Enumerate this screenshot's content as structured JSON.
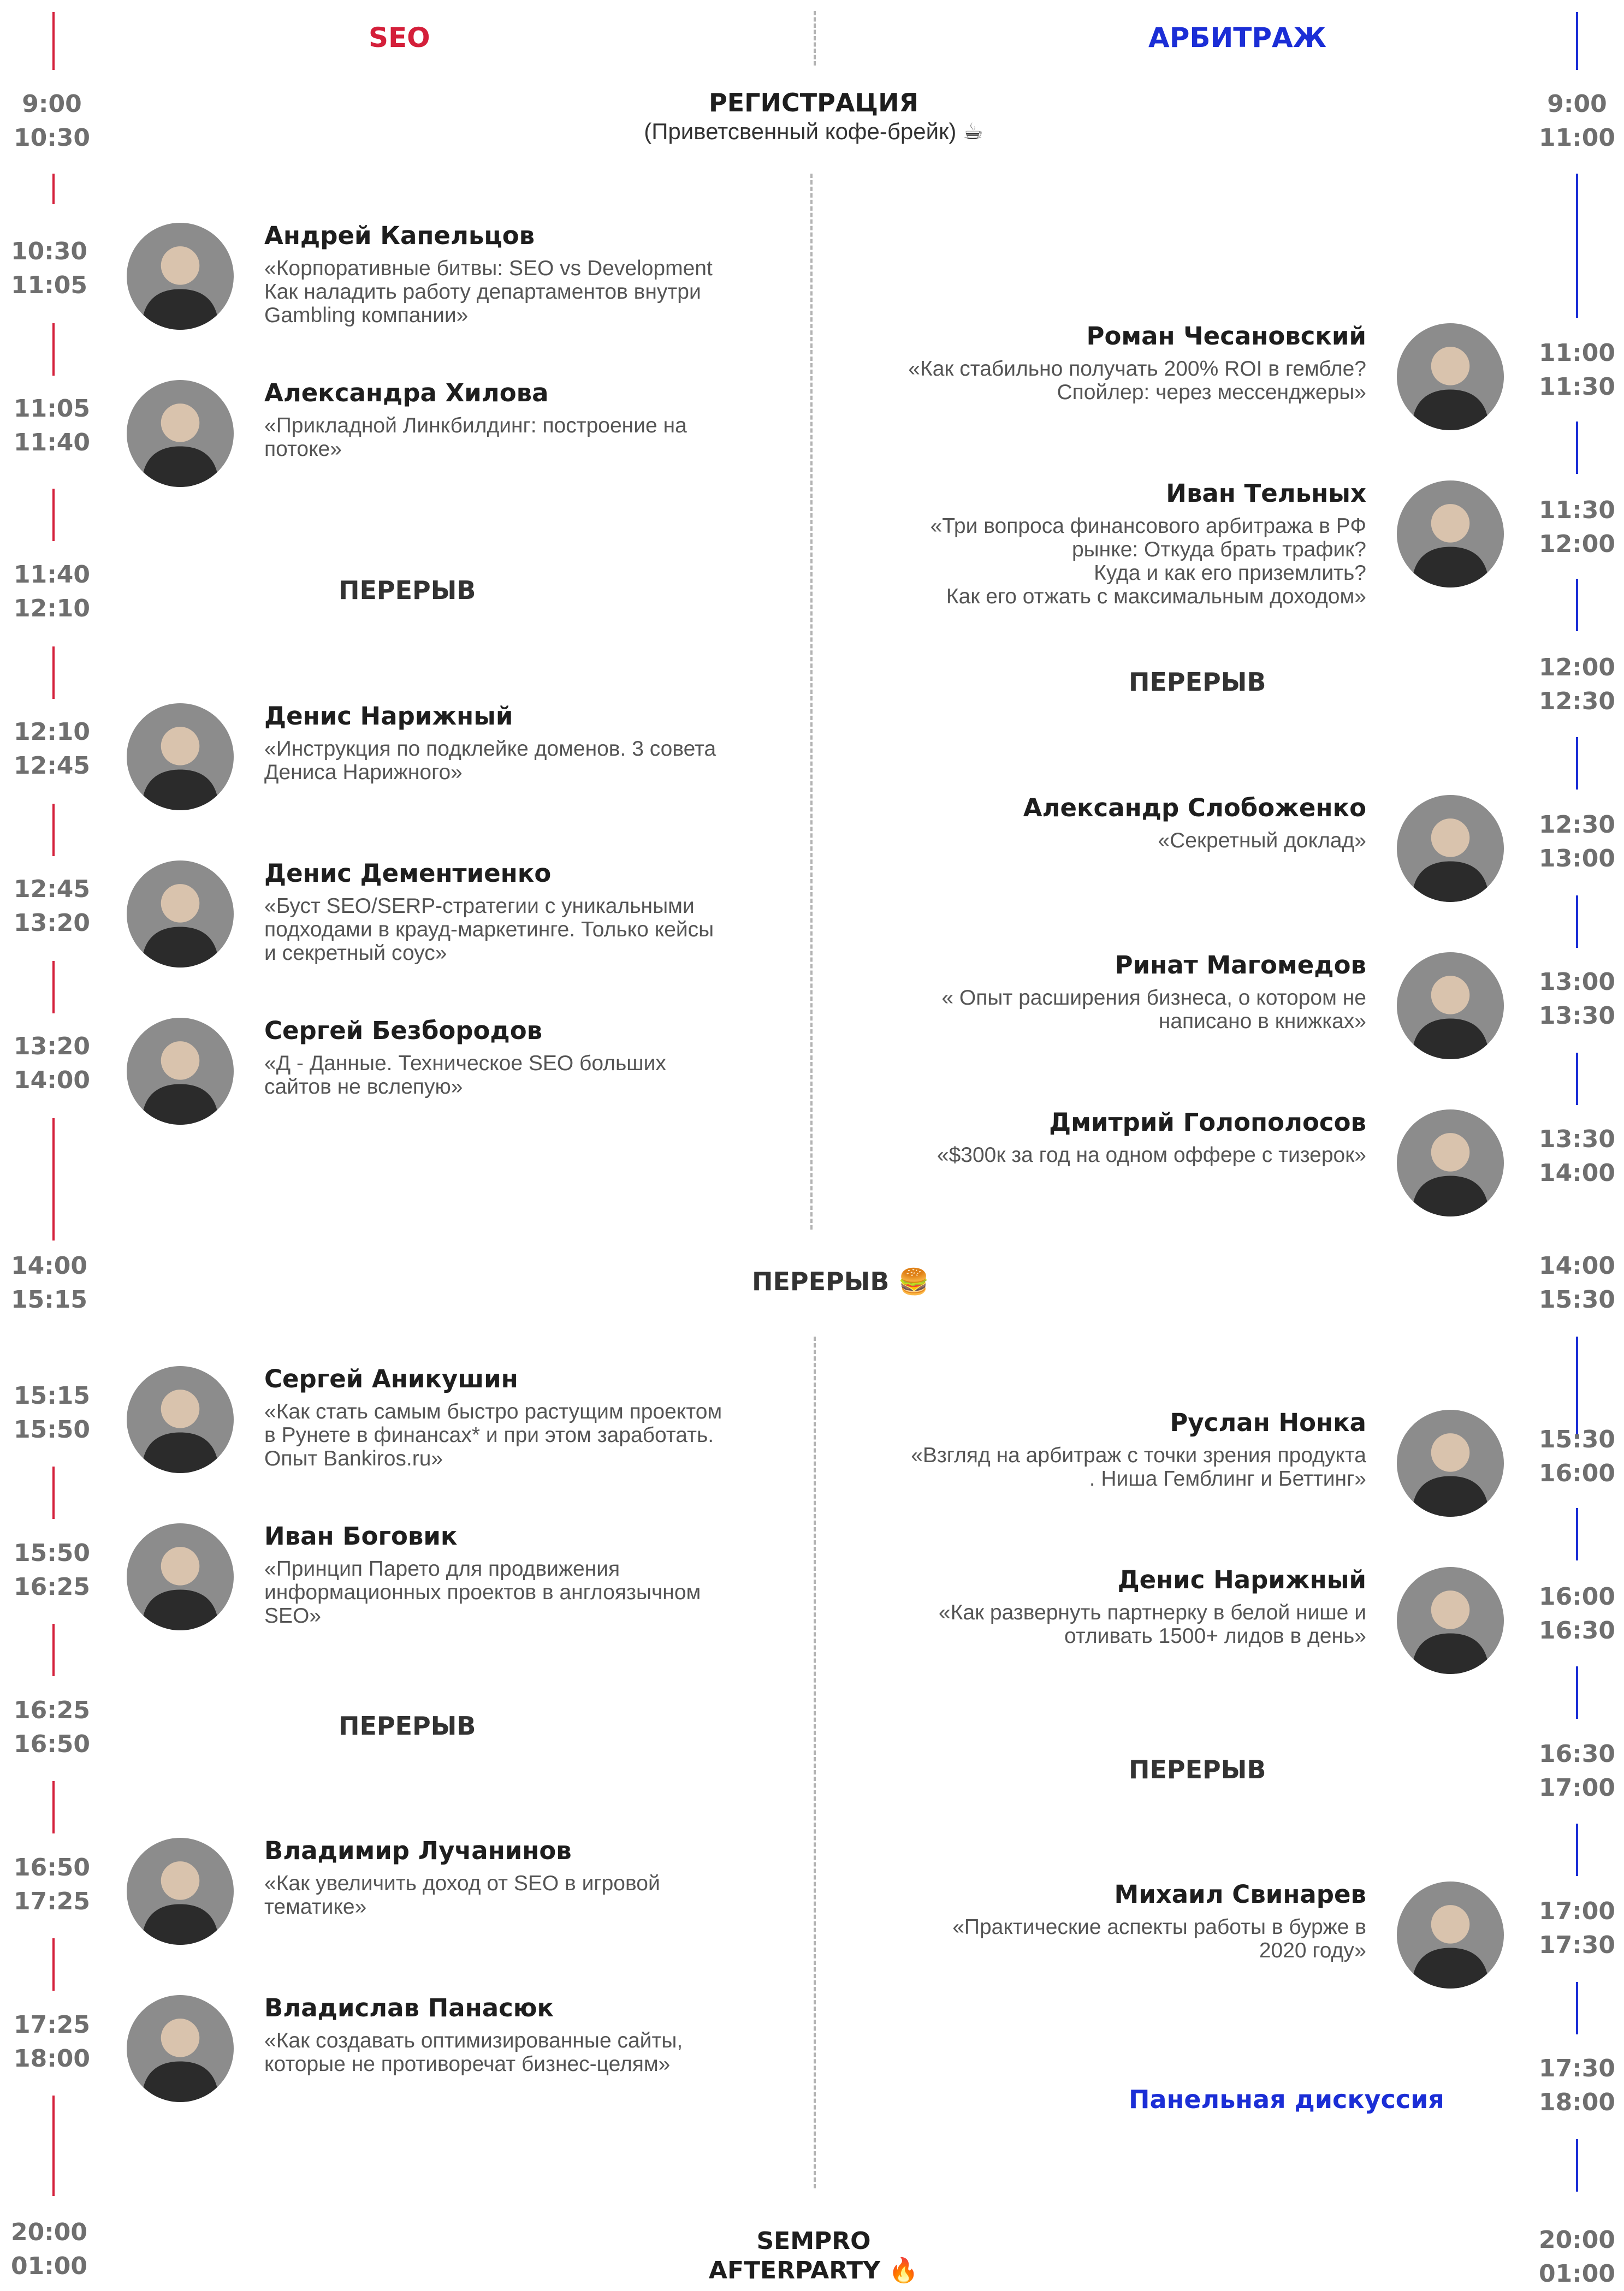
{
  "headers": {
    "seo": "SEO",
    "arb": "АРБИТРАЖ"
  },
  "common": {
    "registration": {
      "time_start": "9:00",
      "time_end_seo": "10:30",
      "time_end_arb": "11:00",
      "title": "РЕГИСТРАЦИЯ",
      "subtitle": "(Приветсвенный кофе-брейк) ☕"
    },
    "lunch": {
      "time_start": "14:00",
      "time_end": "15:15",
      "time_end_arb": "15:30",
      "title": "ПЕРЕРЫВ 🍔"
    },
    "afterparty": {
      "time_start": "20:00",
      "time_end": "01:00",
      "line1": "SEMPRO",
      "line2": "AFTERPARTY 🔥"
    }
  },
  "seo": {
    "slots": [
      {
        "start": "10:30",
        "end": "11:05"
      },
      {
        "start": "11:05",
        "end": "11:40"
      },
      {
        "start": "11:40",
        "end": "12:10"
      },
      {
        "start": "12:10",
        "end": "12:45"
      },
      {
        "start": "12:45",
        "end": "13:20"
      },
      {
        "start": "13:20",
        "end": "14:00"
      },
      {
        "start": "15:15",
        "end": "15:50"
      },
      {
        "start": "15:50",
        "end": "16:25"
      },
      {
        "start": "16:25",
        "end": "16:50"
      },
      {
        "start": "16:50",
        "end": "17:25"
      },
      {
        "start": "17:25",
        "end": "18:00"
      }
    ],
    "speakers": [
      {
        "name": "Андрей Капельцов",
        "talk": "«Корпоративные битвы: SEO vs Development\nКак наладить работу департаментов внутри\nGambling компании»"
      },
      {
        "name": "Александра Хилова",
        "talk": "«Прикладной Линкбилдинг: построение на\nпотоке»"
      },
      {
        "name": "Денис Нарижный",
        "talk": "«Инструкция по подклейке доменов. 3 совета\nДениса Нарижного»"
      },
      {
        "name": "Денис Дементиенко",
        "talk": "«Буст SEO/SERP-стратегии с уникальными\nподходами в крауд-маркетинге. Только кейсы\nи секретный соус»"
      },
      {
        "name": "Сергей Безбородов",
        "talk": "«Д - Данные. Техническое SEO больших\nсайтов не вслепую»"
      },
      {
        "name": "Сергей Аникушин",
        "talk": "«Как стать самым быстро растущим проектом\nв Рунете в финансах* и при этом заработать.\nОпыт Bankiros.ru»"
      },
      {
        "name": "Иван Боговик",
        "talk": "«Принцип Парето для продвижения\nинформационных проектов в англоязычном\nSEO»"
      },
      {
        "name": "Владимир Лучанинов",
        "talk": "«Как увеличить доход от SEO в игровой\nтематике»"
      },
      {
        "name": "Владислав Панасюк",
        "talk": "«Как создавать оптимизированные сайты,\nкоторые не противоречат бизнес-целям»"
      }
    ],
    "break1": "ПЕРЕРЫВ",
    "break2": "ПЕРЕРЫВ"
  },
  "arb": {
    "slots": [
      {
        "start": "11:00",
        "end": "11:30"
      },
      {
        "start": "11:30",
        "end": "12:00"
      },
      {
        "start": "12:00",
        "end": "12:30"
      },
      {
        "start": "12:30",
        "end": "13:00"
      },
      {
        "start": "13:00",
        "end": "13:30"
      },
      {
        "start": "13:30",
        "end": "14:00"
      },
      {
        "start": "15:30",
        "end": "16:00"
      },
      {
        "start": "16:00",
        "end": "16:30"
      },
      {
        "start": "16:30",
        "end": "17:00"
      },
      {
        "start": "17:00",
        "end": "17:30"
      },
      {
        "start": "17:30",
        "end": "18:00"
      }
    ],
    "speakers": [
      {
        "name": "Роман Чесановский",
        "talk": "«Как стабильно получать 200% ROI в гембле?\nСпойлер: через мессенджеры»"
      },
      {
        "name": "Иван Тельных",
        "talk": "«Три вопроса финансового арбитража в РФ\nрынке: Откуда брать трафик?\nКуда и как его приземлить?\nКак его отжать с максимальным доходом»"
      },
      {
        "name": "Александр Слобоженко",
        "talk": "«Секретный доклад»"
      },
      {
        "name": "Ринат Магомедов",
        "talk": "« Опыт расширения бизнеса, о котором не\nнаписано в книжках»"
      },
      {
        "name": "Дмитрий Голополосов",
        "talk": "«$300к за год на одном оффере с тизерок»"
      },
      {
        "name": "Руслан Нонка",
        "talk": "«Взгляд на арбитраж с точки зрения продукта\n. Ниша Гемблинг и Беттинг»"
      },
      {
        "name": "Денис Нарижный",
        "talk": "«Как развернуть партнерку в белой нише и\nотливать 1500+ лидов в день»"
      },
      {
        "name": "Михаил Свинарев",
        "talk": "«Практические аспекты работы в бурже в\n2020 году»"
      }
    ],
    "break1": "ПЕРЕРЫВ",
    "break2": "ПЕРЕРЫВ",
    "panel": "Панельная дискуссия"
  },
  "colors": {
    "seo": "#d41f3a",
    "arb": "#1b2ed6",
    "time": "#6f6f6f"
  }
}
